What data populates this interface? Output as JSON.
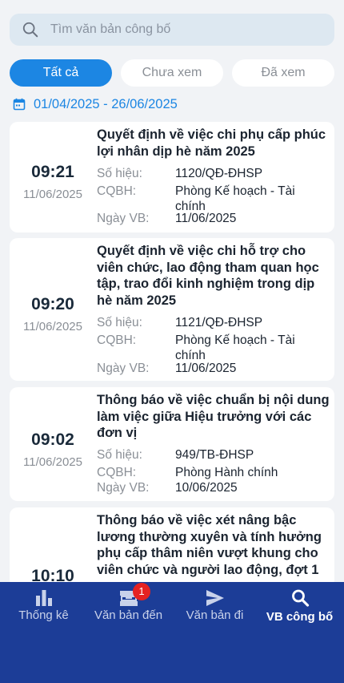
{
  "search": {
    "placeholder": "Tìm văn bản công bố"
  },
  "filters": [
    {
      "label": "Tất cả",
      "active": true
    },
    {
      "label": "Chưa xem",
      "active": false
    },
    {
      "label": "Đã xem",
      "active": false
    }
  ],
  "date_range": "01/04/2025 - 26/06/2025",
  "field_labels": {
    "number": "Số hiệu:",
    "issuer": "CQBH:",
    "doc_date": "Ngày VB:"
  },
  "documents": [
    {
      "time": "09:21",
      "date": "11/06/2025",
      "title": "Quyết định về việc chi phụ cấp phúc lợi nhân dịp hè năm 2025",
      "number": "1120/QĐ-ĐHSP",
      "issuer": "Phòng  Kế hoạch - Tài chính",
      "doc_date": "11/06/2025"
    },
    {
      "time": "09:20",
      "date": "11/06/2025",
      "title": "Quyết định về việc chi hỗ trợ cho viên chức, lao động tham quan học tập, trao đổi kinh nghiệm trong dịp hè năm 2025",
      "number": "1121/QĐ-ĐHSP",
      "issuer": "Phòng  Kế hoạch - Tài chính",
      "doc_date": "11/06/2025"
    },
    {
      "time": "09:02",
      "date": "11/06/2025",
      "title": "Thông báo về việc chuẩn bị nội dung làm việc giữa Hiệu trưởng với các đơn vị",
      "number": "949/TB-ĐHSP",
      "issuer": "Phòng Hành chính",
      "doc_date": "10/06/2025"
    },
    {
      "time": "10:10",
      "date": "",
      "title": "Thông báo về việc xét nâng bậc lương thường xuyên và tính hưởng phụ cấp thâm niên vượt khung cho viên chức và người lao động, đợt 1",
      "number": "",
      "issuer": "",
      "doc_date": ""
    }
  ],
  "tabs": [
    {
      "label": "Thống kê",
      "icon": "bar-chart-icon"
    },
    {
      "label": "Văn bản đến",
      "icon": "inbox-icon",
      "badge": "1"
    },
    {
      "label": "Văn bản đi",
      "icon": "send-icon"
    },
    {
      "label": "VB công bố",
      "icon": "search-icon",
      "active": true
    }
  ],
  "colors": {
    "accent": "#1c86e3",
    "nav_bg": "#1c3d97",
    "badge": "#e52222"
  }
}
